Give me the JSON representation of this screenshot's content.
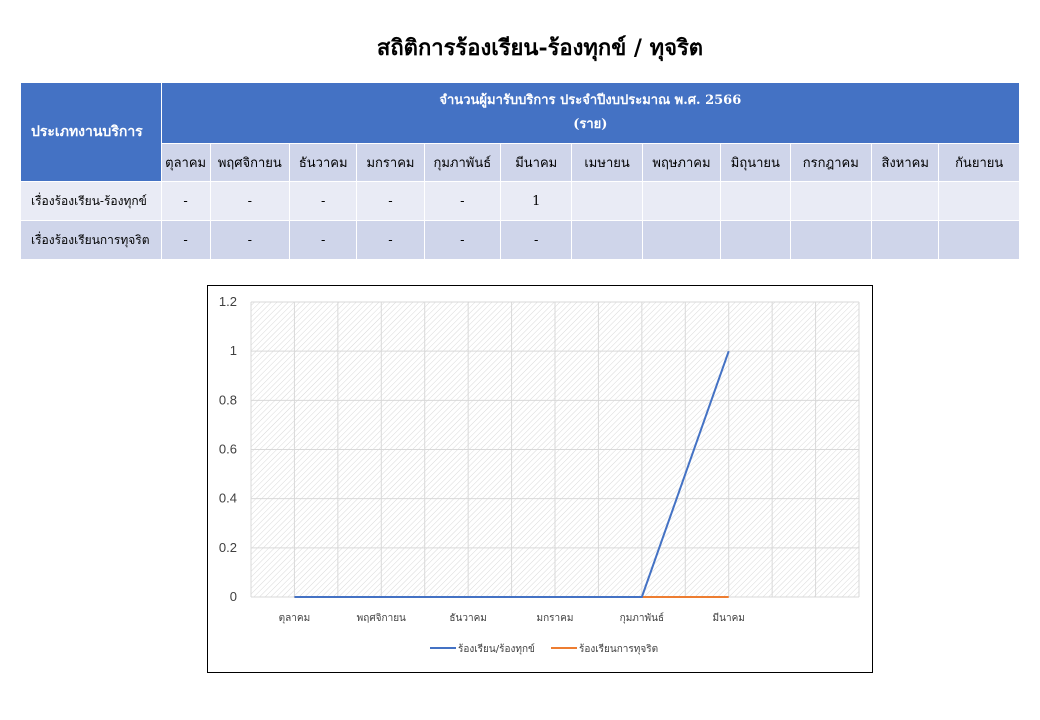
{
  "title": "สถิติการร้องเรียน-ร้องทุกข์ / ทุจริต",
  "table": {
    "type_header": "ประเภทงานบริการ",
    "main_header_line1": "จำนวนผู้มารับบริการ ประจำปีงบประมาณ พ.ศ. 2566",
    "main_header_line2": "(ราย)",
    "months": [
      "ตุลาคม",
      "พฤศจิกายน",
      "ธันวาคม",
      "มกราคม",
      "กุมภาพันธ์",
      "มีนาคม",
      "เมษายน",
      "พฤษภาคม",
      "มิถุนายน",
      "กรกฎาคม",
      "สิงหาคม",
      "กันยายน"
    ],
    "rows": [
      {
        "label": "เรื่องร้องเรียน-ร้องทุกข์",
        "values": [
          "-",
          "-",
          "-",
          "-",
          "-",
          "1",
          "",
          "",
          "",
          "",
          "",
          ""
        ]
      },
      {
        "label": "เรื่องร้องเรียนการทุจริต",
        "values": [
          "-",
          "-",
          "-",
          "-",
          "-",
          "-",
          "",
          "",
          "",
          "",
          "",
          ""
        ]
      }
    ]
  },
  "chart_data": {
    "type": "line",
    "categories": [
      "ตุลาคม",
      "พฤศจิกายน",
      "ธันวาคม",
      "มกราคม",
      "กุมภาพันธ์",
      "มีนาคม"
    ],
    "slots": 7,
    "series": [
      {
        "name": "ร้องเรียน/ร้องทุกข์",
        "color": "#4472c4",
        "values": [
          0,
          0,
          0,
          0,
          0,
          1
        ]
      },
      {
        "name": "ร้องเรียนการทุจริต",
        "color": "#ed7d31",
        "values": [
          0,
          0,
          0,
          0,
          0,
          0
        ]
      }
    ],
    "yticks": [
      "0",
      "0.2",
      "0.4",
      "0.6",
      "0.8",
      "1",
      "1.2"
    ],
    "ylim": [
      0,
      1.2
    ],
    "grid": true,
    "legend": "bottom",
    "pattern_color": "#d9d9d9"
  }
}
